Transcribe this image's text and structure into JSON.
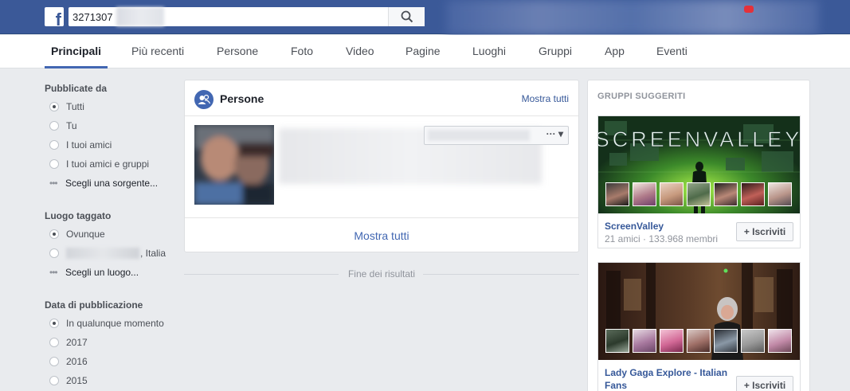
{
  "topbar": {
    "logo": "f",
    "search_value": "3271307",
    "search_icon": "search-icon"
  },
  "tabs": [
    {
      "label": "Principali",
      "active": true
    },
    {
      "label": "Più recenti"
    },
    {
      "label": "Persone"
    },
    {
      "label": "Foto"
    },
    {
      "label": "Video"
    },
    {
      "label": "Pagine"
    },
    {
      "label": "Luoghi"
    },
    {
      "label": "Gruppi"
    },
    {
      "label": "App"
    },
    {
      "label": "Eventi"
    }
  ],
  "filters": {
    "posted_by": {
      "title": "Pubblicate da",
      "options": [
        "Tutti",
        "Tu",
        "I tuoi amici",
        "I tuoi amici e gruppi"
      ],
      "selected": "Tutti",
      "more": "Scegli una sorgente..."
    },
    "tagged_location": {
      "title": "Luogo taggato",
      "options": [
        "Ovunque",
        ", Italia"
      ],
      "selected": "Ovunque",
      "more": "Scegli un luogo..."
    },
    "date_posted": {
      "title": "Data di pubblicazione",
      "options": [
        "In qualunque momento",
        "2017",
        "2016",
        "2015"
      ],
      "selected": "In qualunque momento"
    }
  },
  "people": {
    "title": "Persone",
    "see_all": "Mostra tutti",
    "footer": "Mostra tutti",
    "more": "···",
    "icon": "people-icon"
  },
  "end_of_results": "Fine dei risultati",
  "groups": {
    "title": "GRUPPI SUGGERITI",
    "items": [
      {
        "name": "ScreenValley",
        "cover_text": "SCREENVALLEY",
        "meta": "21 amici · 133.968 membri",
        "join": "+ Iscriviti"
      },
      {
        "name": "Lady Gaga Explore - Italian Fans",
        "join": "+ Iscriviti"
      }
    ]
  },
  "colors": {
    "brand": "#3b5998",
    "link": "#365899",
    "accent": "#4267b2"
  }
}
